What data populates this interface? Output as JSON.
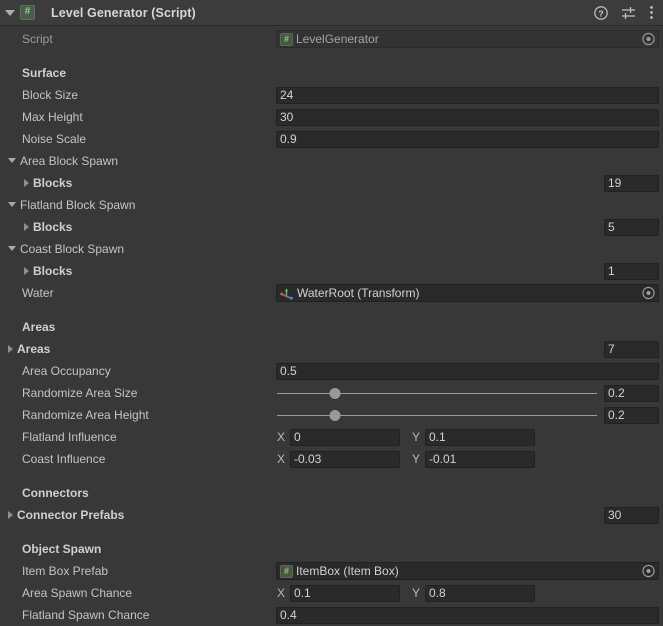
{
  "component": {
    "title": "Level Generator (Script)",
    "icon": "csharp-script-icon",
    "expanded_arrow": "foldout-open-icon",
    "help_icon": "help-icon",
    "preset_icon": "preset-slider-icon",
    "menu_icon": "kebab-menu-icon"
  },
  "script_row": {
    "label": "Script",
    "value": "LevelGenerator",
    "icon": "csharp-script-icon",
    "picker": "object-picker-icon"
  },
  "sections": {
    "surface": {
      "header": "Surface",
      "block_size": {
        "label": "Block Size",
        "value": "24"
      },
      "max_height": {
        "label": "Max Height",
        "value": "30"
      },
      "noise_scale": {
        "label": "Noise Scale",
        "value": "0.9"
      }
    },
    "area_block_spawn": {
      "header": "Area Block Spawn",
      "blocks": {
        "label": "Blocks",
        "value": "19"
      }
    },
    "flatland_block_spawn": {
      "header": "Flatland Block Spawn",
      "blocks": {
        "label": "Blocks",
        "value": "5"
      }
    },
    "coast_block_spawn": {
      "header": "Coast Block Spawn",
      "blocks": {
        "label": "Blocks",
        "value": "1"
      },
      "water": {
        "label": "Water",
        "value": "WaterRoot (Transform)",
        "icon": "transform-axis-icon",
        "picker": "object-picker-icon"
      }
    },
    "areas": {
      "header": "Areas",
      "areas_array": {
        "label": "Areas",
        "value": "7"
      },
      "area_occupancy": {
        "label": "Area Occupancy",
        "value": "0.5"
      },
      "randomize_area_size": {
        "label": "Randomize Area Size",
        "value": "0.2",
        "slider_percent": 18
      },
      "randomize_area_height": {
        "label": "Randomize Area Height",
        "value": "0.2",
        "slider_percent": 18
      },
      "flatland_influence": {
        "label": "Flatland Influence",
        "x_axis": "X",
        "x": "0",
        "y_axis": "Y",
        "y": "0.1"
      },
      "coast_influence": {
        "label": "Coast Influence",
        "x_axis": "X",
        "x": "-0.03",
        "y_axis": "Y",
        "y": "-0.01"
      }
    },
    "connectors": {
      "header": "Connectors",
      "connector_prefabs": {
        "label": "Connector Prefabs",
        "value": "30"
      }
    },
    "object_spawn": {
      "header": "Object Spawn",
      "item_box_prefab": {
        "label": "Item Box Prefab",
        "value": "ItemBox (Item Box)",
        "icon": "csharp-script-icon",
        "picker": "object-picker-icon"
      },
      "area_spawn_chance": {
        "label": "Area Spawn Chance",
        "x_axis": "X",
        "x": "0.1",
        "y_axis": "Y",
        "y": "0.8"
      },
      "flatland_spawn_chance": {
        "label": "Flatland Spawn Chance",
        "value": "0.4"
      }
    }
  },
  "colors": {
    "background": "#383838",
    "header_bg": "#3c3c3c",
    "field_bg": "#2a2a2a",
    "text": "#c4c4c4"
  }
}
